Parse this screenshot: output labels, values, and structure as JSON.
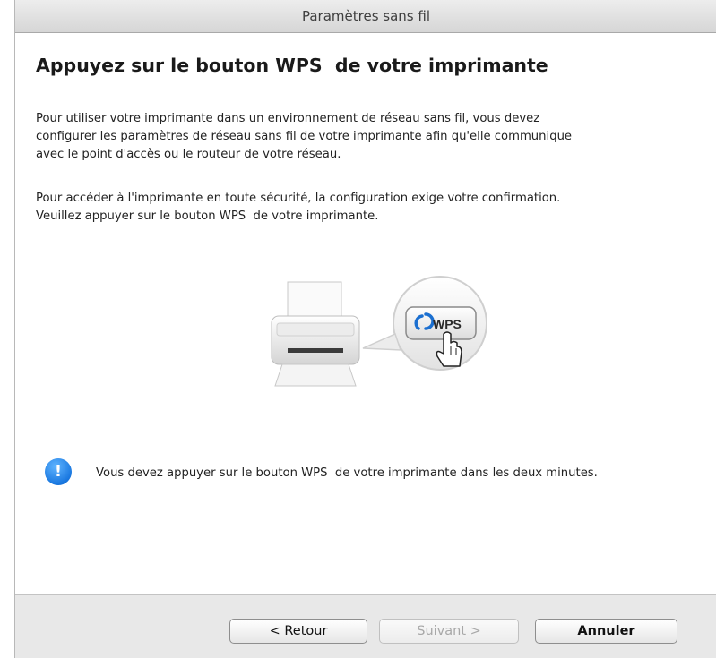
{
  "window": {
    "title": "Paramètres sans fil"
  },
  "main": {
    "heading": "Appuyez sur le bouton WPS  de votre imprimante",
    "paragraph1": [
      "Pour utiliser votre imprimante dans un environnement de réseau sans fil, vous devez",
      "configurer les paramètres de réseau sans fil de votre imprimante afin qu'elle communique",
      "avec le point d'accès ou le routeur de votre réseau."
    ],
    "paragraph2": [
      "Pour accéder à l'imprimante en toute sécurité, la configuration exige votre confirmation.",
      "Veuillez appuyer sur le bouton WPS  de votre imprimante."
    ],
    "illustration": {
      "wps_label": "WPS"
    },
    "notice": {
      "icon": "info-exclamation-icon",
      "icon_glyph": "!",
      "text": "Vous devez appuyer sur le bouton WPS  de votre imprimante dans les deux minutes."
    }
  },
  "footer": {
    "back_label": "< Retour",
    "next_label": "Suivant >",
    "cancel_label": "Annuler"
  },
  "colors": {
    "accent_blue": "#1a78e0",
    "wps_blue": "#1b6fd0",
    "title_bar": "#e0e0e0",
    "footer": "#e8e8e8"
  }
}
